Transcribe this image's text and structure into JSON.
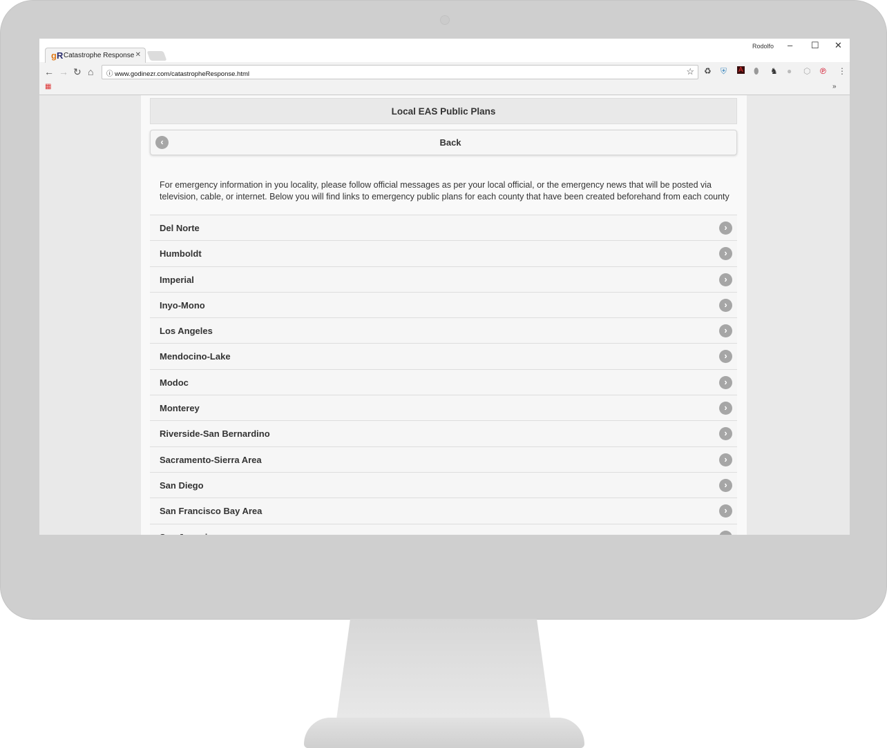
{
  "browser": {
    "tab_title": "Catastrophe Response",
    "logo_text": "gR",
    "profile": "Rodolfo",
    "url": "www.godinezr.com/catastropheResponse.html"
  },
  "page": {
    "title": "Local EAS Public Plans",
    "back_label": "Back",
    "intro": "For emergency information in you locality, please follow official messages as per your local official, or the emergency news that will be posted via television, cable, or internet. Below you will find links to emergency public plans for each county that have been created beforehand from each county",
    "counties": [
      "Del Norte",
      "Humboldt",
      "Imperial",
      "Inyo-Mono",
      "Los Angeles",
      "Mendocino-Lake",
      "Modoc",
      "Monterey",
      "Riverside-San Bernardino",
      "Sacramento-Sierra Area",
      "San Diego",
      "San Francisco Bay Area",
      "San Joaquin"
    ]
  }
}
